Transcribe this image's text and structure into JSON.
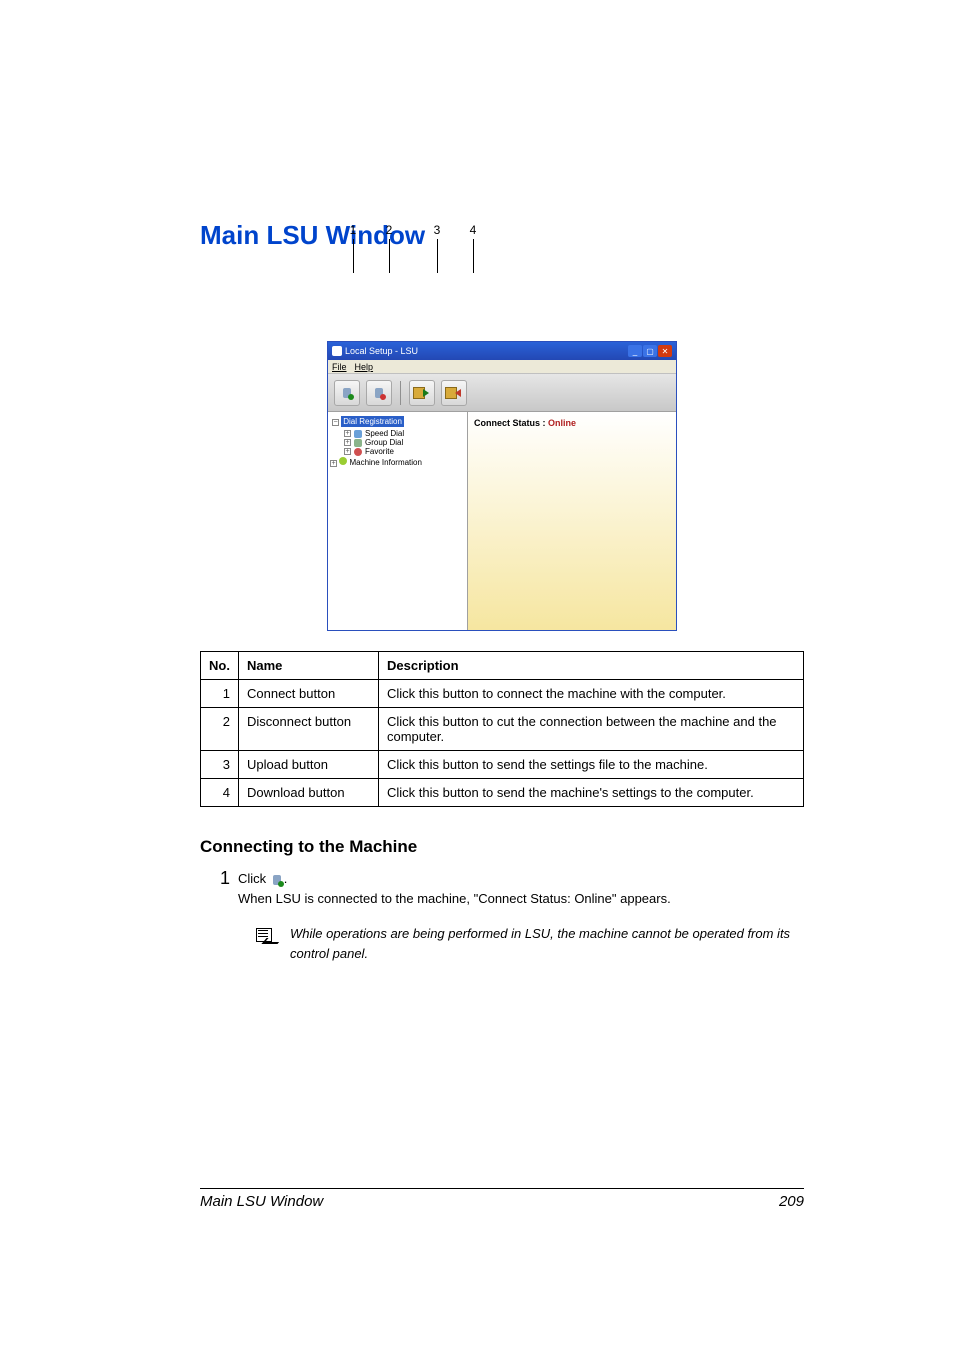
{
  "heading": "Main LSU Window",
  "pointers": [
    "1",
    "2",
    "3",
    "4"
  ],
  "window": {
    "title": "Local Setup - LSU",
    "menu": {
      "file": "File",
      "help": "Help"
    },
    "tree": {
      "root": "Dial Registration",
      "speed": "Speed Dial",
      "group": "Group Dial",
      "favorite": "Favorite",
      "machine": "Machine Information"
    },
    "status_label": "Connect Status : ",
    "status_value": "Online"
  },
  "table": {
    "headers": {
      "no": "No.",
      "name": "Name",
      "desc": "Description"
    },
    "rows": [
      {
        "no": "1",
        "name": "Connect button",
        "desc": "Click this button to connect the machine with the computer."
      },
      {
        "no": "2",
        "name": "Disconnect button",
        "desc": "Click this button to cut the connection between the machine and the computer."
      },
      {
        "no": "3",
        "name": "Upload button",
        "desc": "Click this button to send the settings file to the machine."
      },
      {
        "no": "4",
        "name": "Download button",
        "desc": "Click this button to send the machine's settings to the computer."
      }
    ]
  },
  "subheading": "Connecting to the Machine",
  "step1": {
    "num": "1",
    "click": "Click ",
    "period": ".",
    "body": "When LSU is connected to the machine, \"Connect Status: Online\" appears."
  },
  "note": "While operations are being performed in LSU, the machine cannot be operated from its control panel.",
  "footer": {
    "left": "Main LSU Window",
    "right": "209"
  }
}
